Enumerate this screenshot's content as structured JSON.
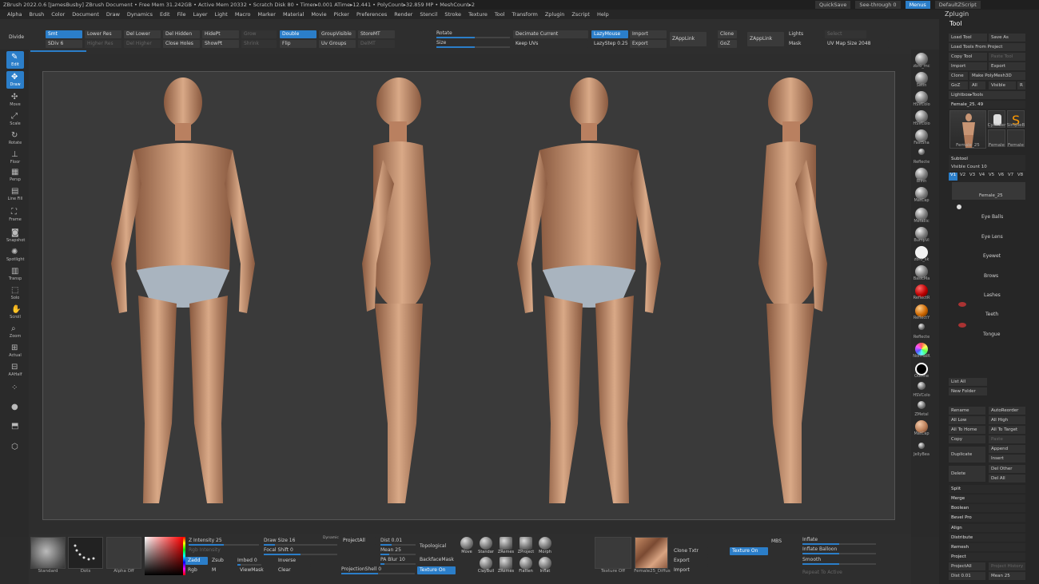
{
  "titlebar": {
    "text": "ZBrush 2022.0.6 [JamesBusby]   ZBrush Document      • Free Mem 31.242GB • Active Mem 20332 • Scratch Disk 80 •  Timer▸0.001 ATime▸12.441 • PolyCount▸32.859 MP  • MeshCount▸2",
    "quicksave": "QuickSave",
    "see_through": "See-through  0",
    "menus": "Menus",
    "default_script": "DefaultZScript"
  },
  "menubar": [
    "Alpha",
    "Brush",
    "Color",
    "Document",
    "Draw",
    "Dynamics",
    "Edit",
    "File",
    "Layer",
    "Light",
    "Macro",
    "Marker",
    "Material",
    "Movie",
    "Picker",
    "Preferences",
    "Render",
    "Stencil",
    "Stroke",
    "Texture",
    "Tool",
    "Transform",
    "Zplugin",
    "Zscript",
    "Help"
  ],
  "top": {
    "divide": "Divide",
    "smt": "Smt",
    "sdiv": "SDiv 6",
    "lower_res": "Lower Res",
    "higher_res": "Higher Res",
    "del_lower": "Del Lower",
    "del_higher": "Del Higher",
    "del_hidden": "Del Hidden",
    "close_holes": "Close Holes",
    "hidept": "HidePt",
    "showpt": "ShowPt",
    "grow": "Grow",
    "shrink": "Shrink",
    "double": "Double",
    "flip": "Flip",
    "groupvisible": "GroupVisible",
    "uvgroups": "Uv Groups",
    "storemt": "StoreMT",
    "delmt": "DelMT",
    "rotate": "Rotate",
    "size": "Size",
    "decimate": "Decimate Current",
    "keep_uvs": "Keep UVs",
    "lazymouse": "LazyMouse",
    "lazystep": "LazyStep 0.25",
    "import": "Import",
    "export": "Export",
    "zapplink1": "ZAppLink",
    "clone": "Clone",
    "goz": "GoZ",
    "zapplink2": "ZAppLink",
    "lights": "Lights",
    "mask": "Mask",
    "select": "Select",
    "uv_map_size": "UV Map Size 2048"
  },
  "left_tools": [
    "Edit",
    "Draw",
    "Move",
    "Scale",
    "Rotate",
    "Floor",
    "Persp",
    "Line Fill",
    "Frame",
    "Snapshot",
    "Spotlight",
    "Transp",
    "Solo",
    "Scroll",
    "Zoom",
    "Actual",
    "AAHalf",
    "Dynamic",
    "BPR",
    "Ghost",
    "Xpose"
  ],
  "materials": [
    "zbro_mc",
    "Satin",
    "HSVColo",
    "HSVColo",
    "FastSha",
    "Reflecte",
    "Blinn",
    "MatCap",
    "Metallic",
    "BumpVi",
    "zbro_sk",
    "BasicMa",
    "ReflectR",
    "ReflectY",
    "Reflecte",
    "NormalR",
    "Outline",
    "HSVColo",
    "ZMetal",
    "MatCap",
    "JellyBea"
  ],
  "tool_panel": {
    "zplugin": "Zplugin",
    "tool": "Tool",
    "load_tool": "Load Tool",
    "save_as": "Save As",
    "load_from_project": "Load Tools From Project",
    "copy_tool": "Copy Tool",
    "paste_tool": "Paste Tool",
    "import": "Import",
    "export": "Export",
    "clone": "Clone",
    "make_polymesh": "Make PolyMesh3D",
    "goz": "GoZ",
    "all": "All",
    "visible": "Visible",
    "r": "R",
    "lightbox": "Lightbox▸Tools",
    "current_tool": "Female_25. 49",
    "thumbs": [
      "Female_25",
      "Cylinder",
      "SimpleB",
      "Female",
      "Female"
    ],
    "subtool": "Subtool",
    "visible_count": "Visible Count 10",
    "versions": [
      "V1",
      "V2",
      "V3",
      "V4",
      "V5",
      "V6",
      "V7",
      "V8"
    ],
    "subtools": [
      "Female_25",
      "Eye Balls",
      "Eye Lens",
      "Eyewet",
      "Brows",
      "Lashes",
      "Teeth",
      "Tongue"
    ],
    "list_all": "List All",
    "new_folder": "New Folder",
    "rename": "Rename",
    "autoreorder": "AutoReorder",
    "all_low": "All Low",
    "all_high": "All High",
    "all_to_home": "All To Home",
    "all_to_target": "All To Target",
    "copy": "Copy",
    "paste": "Paste",
    "duplicate": "Duplicate",
    "append": "Append",
    "insert": "Insert",
    "delete": "Delete",
    "del_other": "Del Other",
    "del_all": "Del All",
    "sections": [
      "Split",
      "Merge",
      "Boolean",
      "Bevel Pro",
      "Align",
      "Distribute",
      "Remesh",
      "Project"
    ],
    "projectall": "ProjectAll",
    "project_history": "Project History",
    "dist": "Dist 0.01",
    "mean": "Mean 25"
  },
  "bottom": {
    "brush": "Standard",
    "stroke": "Dots",
    "alpha": "Alpha Off",
    "z_intensity": "Z Intensity 25",
    "rgb_intensity": "Rgb Intensity",
    "zadd": "Zadd",
    "zsub": "Zsub",
    "imbed": "Imbed 0",
    "rgb": "Rgb",
    "m": "M",
    "draw_size": "Draw Size 16",
    "dynamic": "Dynamic",
    "focal_shift": "Focal Shift 0",
    "inverse": "Inverse",
    "viewmask": "ViewMask",
    "clear": "Clear",
    "projectall": "ProjectAll",
    "dist": "Dist 0.01",
    "mean": "Mean 25",
    "pa_blur": "PA Blur 10",
    "projectionshell": "ProjectionShell 0",
    "topological": "Topological",
    "backfacemask": "BackfaceMask",
    "texture_on": "Texture On",
    "brushes": [
      "Move",
      "Standar",
      "ZRemes",
      "ZProject",
      "Morph",
      "ClayBuil",
      "ZRemes",
      "Flatten",
      "Inflat"
    ],
    "texture_off": "Texture Off",
    "texture_name": "Female25_Diffus",
    "clone_txtr": "Clone Txtr",
    "export": "Export",
    "import": "Import",
    "texture_on2": "Texture On",
    "mbs": "MBS",
    "inflate": "Inflate",
    "inflate_balloon": "Inflate Balloon",
    "smooth": "Smooth",
    "repeat_to_active": "Repeat To Active"
  },
  "colors": {
    "accent": "#2b7ec9",
    "panel": "#2e2e2e",
    "canvas": "#3a3a3a"
  }
}
